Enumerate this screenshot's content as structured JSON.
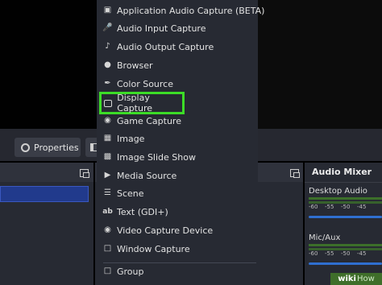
{
  "menu": {
    "items": [
      {
        "label": "Application Audio Capture (BETA)",
        "icon": "window-audio-icon"
      },
      {
        "label": "Audio Input Capture",
        "icon": "microphone-icon"
      },
      {
        "label": "Audio Output Capture",
        "icon": "speaker-icon"
      },
      {
        "label": "Browser",
        "icon": "globe-icon"
      },
      {
        "label": "Color Source",
        "icon": "brush-icon"
      },
      {
        "label": "Display Capture",
        "icon": "monitor-icon"
      },
      {
        "label": "Game Capture",
        "icon": "gamepad-icon"
      },
      {
        "label": "Image",
        "icon": "image-icon"
      },
      {
        "label": "Image Slide Show",
        "icon": "slideshow-icon"
      },
      {
        "label": "Media Source",
        "icon": "play-icon"
      },
      {
        "label": "Scene",
        "icon": "list-icon"
      },
      {
        "label": "Text (GDI+)",
        "icon": "text-icon"
      },
      {
        "label": "Video Capture Device",
        "icon": "camera-icon"
      },
      {
        "label": "Window Capture",
        "icon": "window-icon"
      },
      {
        "label": "Group",
        "icon": "folder-icon"
      }
    ],
    "highlighted": "Display Capture",
    "highlight_color": "#3cdc27"
  },
  "toolbar": {
    "properties_label": "Properties"
  },
  "mixer": {
    "title": "Audio Mixer",
    "ticks": [
      "-60",
      "-55",
      "-50",
      "-45"
    ],
    "tracks": [
      {
        "name": "Desktop Audio"
      },
      {
        "name": "Mic/Aux"
      }
    ]
  },
  "watermark": {
    "brand": "wiki",
    "suffix": "How"
  }
}
